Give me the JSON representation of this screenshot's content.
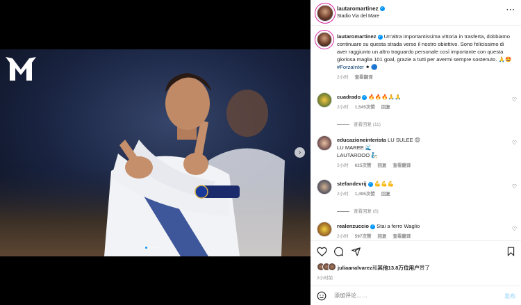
{
  "header": {
    "username": "lautaromartinez",
    "location": "Stadio Via del Mare",
    "more_icon": "more-horizontal-icon"
  },
  "caption": {
    "username": "lautaromartinez",
    "text": "Un'altra importantissima vittoria in trasferta, dobbiamo continuare su questa strada verso il nostro obiettivo. Sono felicissimo di aver raggiunto un altro traguardo personale così importante con questa gloriosa maglia 101 goal, grazie a tutti per avermi sempre sostenuto. 🙏🤩",
    "hashtag": "#ForzaInter",
    "tail": " ⚫ 🔵",
    "time": "2小时",
    "see_translation": "查看翻译"
  },
  "comments": [
    {
      "username": "cuadrado",
      "text": "🔥🔥🔥🙏🙏",
      "time": "2小时",
      "likes": "1,545次赞",
      "reply": "回复",
      "view_replies": "查看回复 (11)"
    },
    {
      "username": "educazioneinterista",
      "text": "LU SULEE 😊",
      "line2": "LU MAREE 🌊",
      "line3": "LAUTAROOO 🧞",
      "time": "2小时",
      "likes": "625次赞",
      "reply": "回复",
      "see_translation": "查看翻译"
    },
    {
      "username": "stefandevrij",
      "text": "💪💪💪",
      "time": "2小时",
      "likes": "1,495次赞",
      "reply": "回复",
      "view_replies": "查看回复 (6)"
    },
    {
      "username": "realenzuccio",
      "text": "Stai a ferro Waglio",
      "time": "2小时",
      "likes": "597次赞",
      "reply": "回复",
      "see_translation": "查看翻译"
    }
  ],
  "actions": {
    "like_icon": "heart-icon",
    "comment_icon": "comment-icon",
    "share_icon": "share-icon",
    "save_icon": "bookmark-icon"
  },
  "likes": {
    "user": "juliaanalvarez",
    "mid": "和",
    "others": "其他13.8万位用户",
    "end": "赞了"
  },
  "post_time": "2小时前",
  "add_comment": {
    "placeholder": "添加评论……",
    "post_label": "发布"
  },
  "colors": {
    "accent": "#0095f6",
    "link": "#00376b"
  }
}
